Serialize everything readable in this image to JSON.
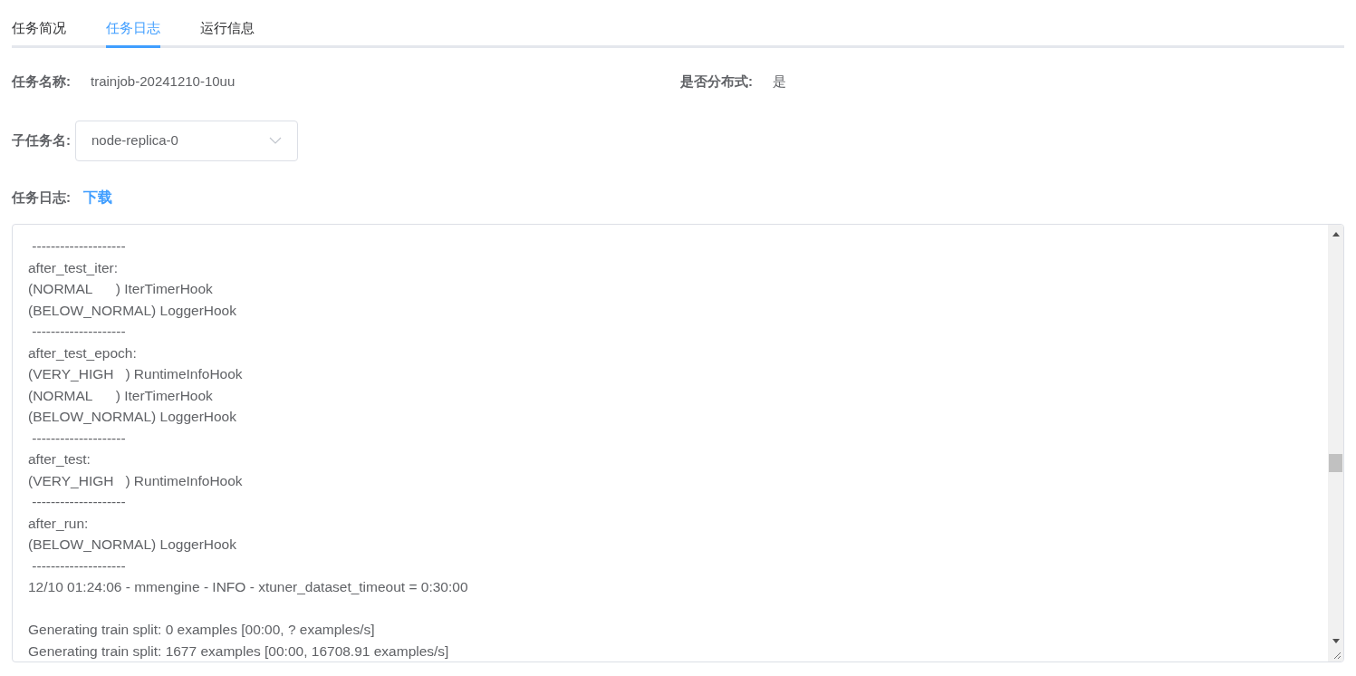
{
  "tabs": [
    {
      "label": "任务简况",
      "selected": false
    },
    {
      "label": "任务日志",
      "selected": true
    },
    {
      "label": "运行信息",
      "selected": false
    }
  ],
  "info": [
    {
      "label": "任务名称:",
      "value": "trainjob-20241210-10uu"
    },
    {
      "label": "是否分布式:",
      "value": "是"
    }
  ],
  "subtask": {
    "label": "子任务名:",
    "value": "node-replica-0"
  },
  "log": {
    "label": "任务日志:",
    "download": "下载",
    "lines": [
      {
        "text": " --------------------"
      },
      {
        "text": "after_test_iter:"
      },
      {
        "text": "(NORMAL      ) IterTimerHook"
      },
      {
        "text": "(BELOW_NORMAL) LoggerHook"
      },
      {
        "text": " --------------------"
      },
      {
        "text": "after_test_epoch:"
      },
      {
        "text": "(VERY_HIGH   ) RuntimeInfoHook"
      },
      {
        "text": "(NORMAL      ) IterTimerHook"
      },
      {
        "text": "(BELOW_NORMAL) LoggerHook"
      },
      {
        "text": " --------------------"
      },
      {
        "text": "after_test:"
      },
      {
        "text": "(VERY_HIGH   ) RuntimeInfoHook"
      },
      {
        "text": " --------------------"
      },
      {
        "text": "after_run:"
      },
      {
        "text": "(BELOW_NORMAL) LoggerHook"
      },
      {
        "text": " --------------------"
      },
      {
        "text": "12/10 01:24:06 - mmengine - INFO - xtuner_dataset_timeout = 0:30:00"
      },
      {
        "text": "Generating train split: 0 examples [00:00, ? examples/s]",
        "blank_before": true
      },
      {
        "text": "Generating train split: 1677 examples [00:00, 16708.91 examples/s]"
      }
    ]
  }
}
